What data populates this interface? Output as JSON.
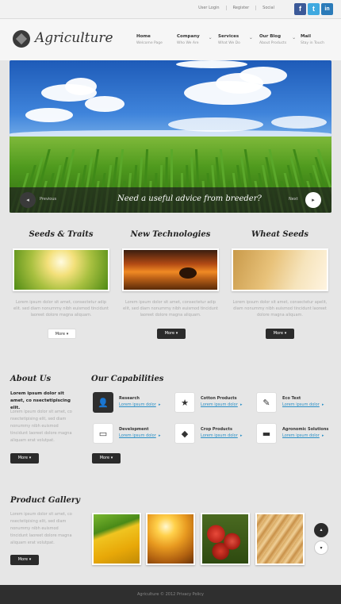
{
  "topbar": {
    "links": [
      "User Login",
      "Register",
      "Social"
    ],
    "social": [
      {
        "icon": "facebook-icon",
        "glyph": "f",
        "color": "#3b5998"
      },
      {
        "icon": "twitter-icon",
        "glyph": "t",
        "color": "#3fa9e0"
      },
      {
        "icon": "linkedin-icon",
        "glyph": "in",
        "color": "#2b7bb9"
      }
    ]
  },
  "header": {
    "logo": "Agriculture",
    "nav": [
      {
        "title": "Home",
        "sub": "Welcome Page"
      },
      {
        "title": "Company",
        "sub": "Who We Are"
      },
      {
        "title": "Services",
        "sub": "What We Do"
      },
      {
        "title": "Our Blog",
        "sub": "About Products"
      },
      {
        "title": "Mail",
        "sub": "Stay in Touch"
      }
    ]
  },
  "slider": {
    "caption": "Need a useful advice from breeder?",
    "prev": "Previous",
    "next": "Next"
  },
  "features": [
    {
      "title": "Seeds & Traits",
      "text": "Lorem ipsum dolor sit amet, consectetur adip elit. sed diam nonummy nibh euismod tincidunt laoreet dolore magna aliquam."
    },
    {
      "title": "New Technologies",
      "text": "Lorem ipsum dolor sit amet, consectetur adip elit, sed diam nonummy nibh euismod tincidunt laoreet dolore magna aliquam."
    },
    {
      "title": "Wheat Seeds",
      "text": "Lorem ipsum dolor sit amet, consectetur apelit, diam nonummy nibh euismod tincidunt laoreet dolore magna aliquam."
    }
  ],
  "more_label": "More",
  "about": {
    "title": "About Us",
    "bold": "Lorem ipsum dolor sit amet, co nsectetipiscing elit.",
    "text": "Lorem ipsum dolor sit amet, co nsectetipising elit, sed diam nonummy nibh euismod tincidunt laoreet dolore magna aliquam erat volutpat."
  },
  "capabilities": {
    "title": "Our Capabilities",
    "items": [
      {
        "title": "Research",
        "link": "Lorem ipsum dolor",
        "icon": "user-icon",
        "glyph": "👤",
        "dark": true
      },
      {
        "title": "Cotton Products",
        "link": "Lorem ipsum dolor",
        "icon": "star-icon",
        "glyph": "★",
        "dark": false
      },
      {
        "title": "Eco Text",
        "link": "Lorem ipsum dolor",
        "icon": "pencil-icon",
        "glyph": "✎",
        "dark": false
      },
      {
        "title": "Development",
        "link": "Lorem ipsum dolor",
        "icon": "monitor-icon",
        "glyph": "▭",
        "dark": false
      },
      {
        "title": "Crop Products",
        "link": "Lorem ipsum dolor",
        "icon": "tag-icon",
        "glyph": "◆",
        "dark": false
      },
      {
        "title": "Agronomic Solutions",
        "link": "Lorem ipsum dolor",
        "icon": "folder-icon",
        "glyph": "▬",
        "dark": false
      }
    ]
  },
  "gallery": {
    "title": "Product Gallery",
    "text": "Lorem ipsum dolor sit amet, co nsectetipising elit, sed diam nonummy nibh euismod tincidunt laoreet dolore magna aliquam erat volutpat."
  },
  "footer": "Agriculture © 2012 Privacy Policy"
}
